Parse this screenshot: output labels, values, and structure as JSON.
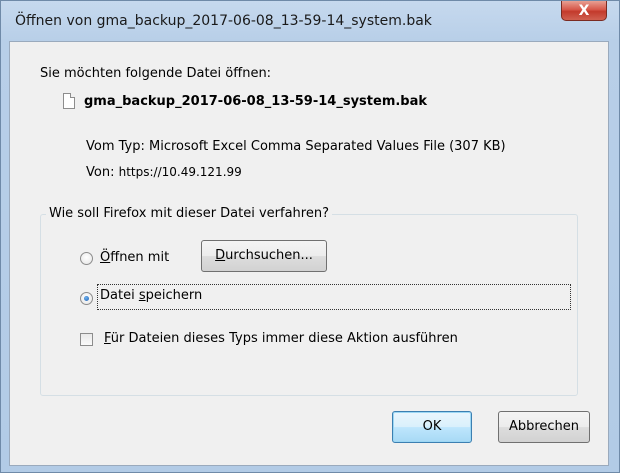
{
  "window": {
    "title": "Öffnen von gma_backup_2017-06-08_13-59-14_system.bak",
    "close_label": "X"
  },
  "dialog": {
    "prompt": "Sie möchten folgende Datei öffnen:",
    "filename": "gma_backup_2017-06-08_13-59-14_system.bak",
    "type_label": "Vom Typ:",
    "type_value": "Microsoft Excel Comma Separated Values File (307 KB)",
    "source_label": "Von:",
    "source_value": "https://10.49.121.99",
    "icon": "file-icon"
  },
  "action_group": {
    "legend": "Wie soll Firefox mit dieser Datei verfahren?",
    "open_with": {
      "mnemonic": "Ö",
      "rest": "ffnen mit",
      "selected": false
    },
    "browse": {
      "mnemonic": "D",
      "rest": "urchsuchen..."
    },
    "save_file": {
      "prefix": "Datei ",
      "mnemonic": "s",
      "rest": "peichern",
      "selected": true
    },
    "always": {
      "mnemonic": "F",
      "rest": "ür Dateien dieses Typs immer diese Aktion ausführen",
      "checked": false
    }
  },
  "buttons": {
    "ok": "OK",
    "cancel": "Abbrechen"
  },
  "colors": {
    "title_bar": "#b8cfe8",
    "close_button": "#c23a2c",
    "client_background": "#f0f0f0",
    "focused_button_border": "#3c7fb1"
  }
}
